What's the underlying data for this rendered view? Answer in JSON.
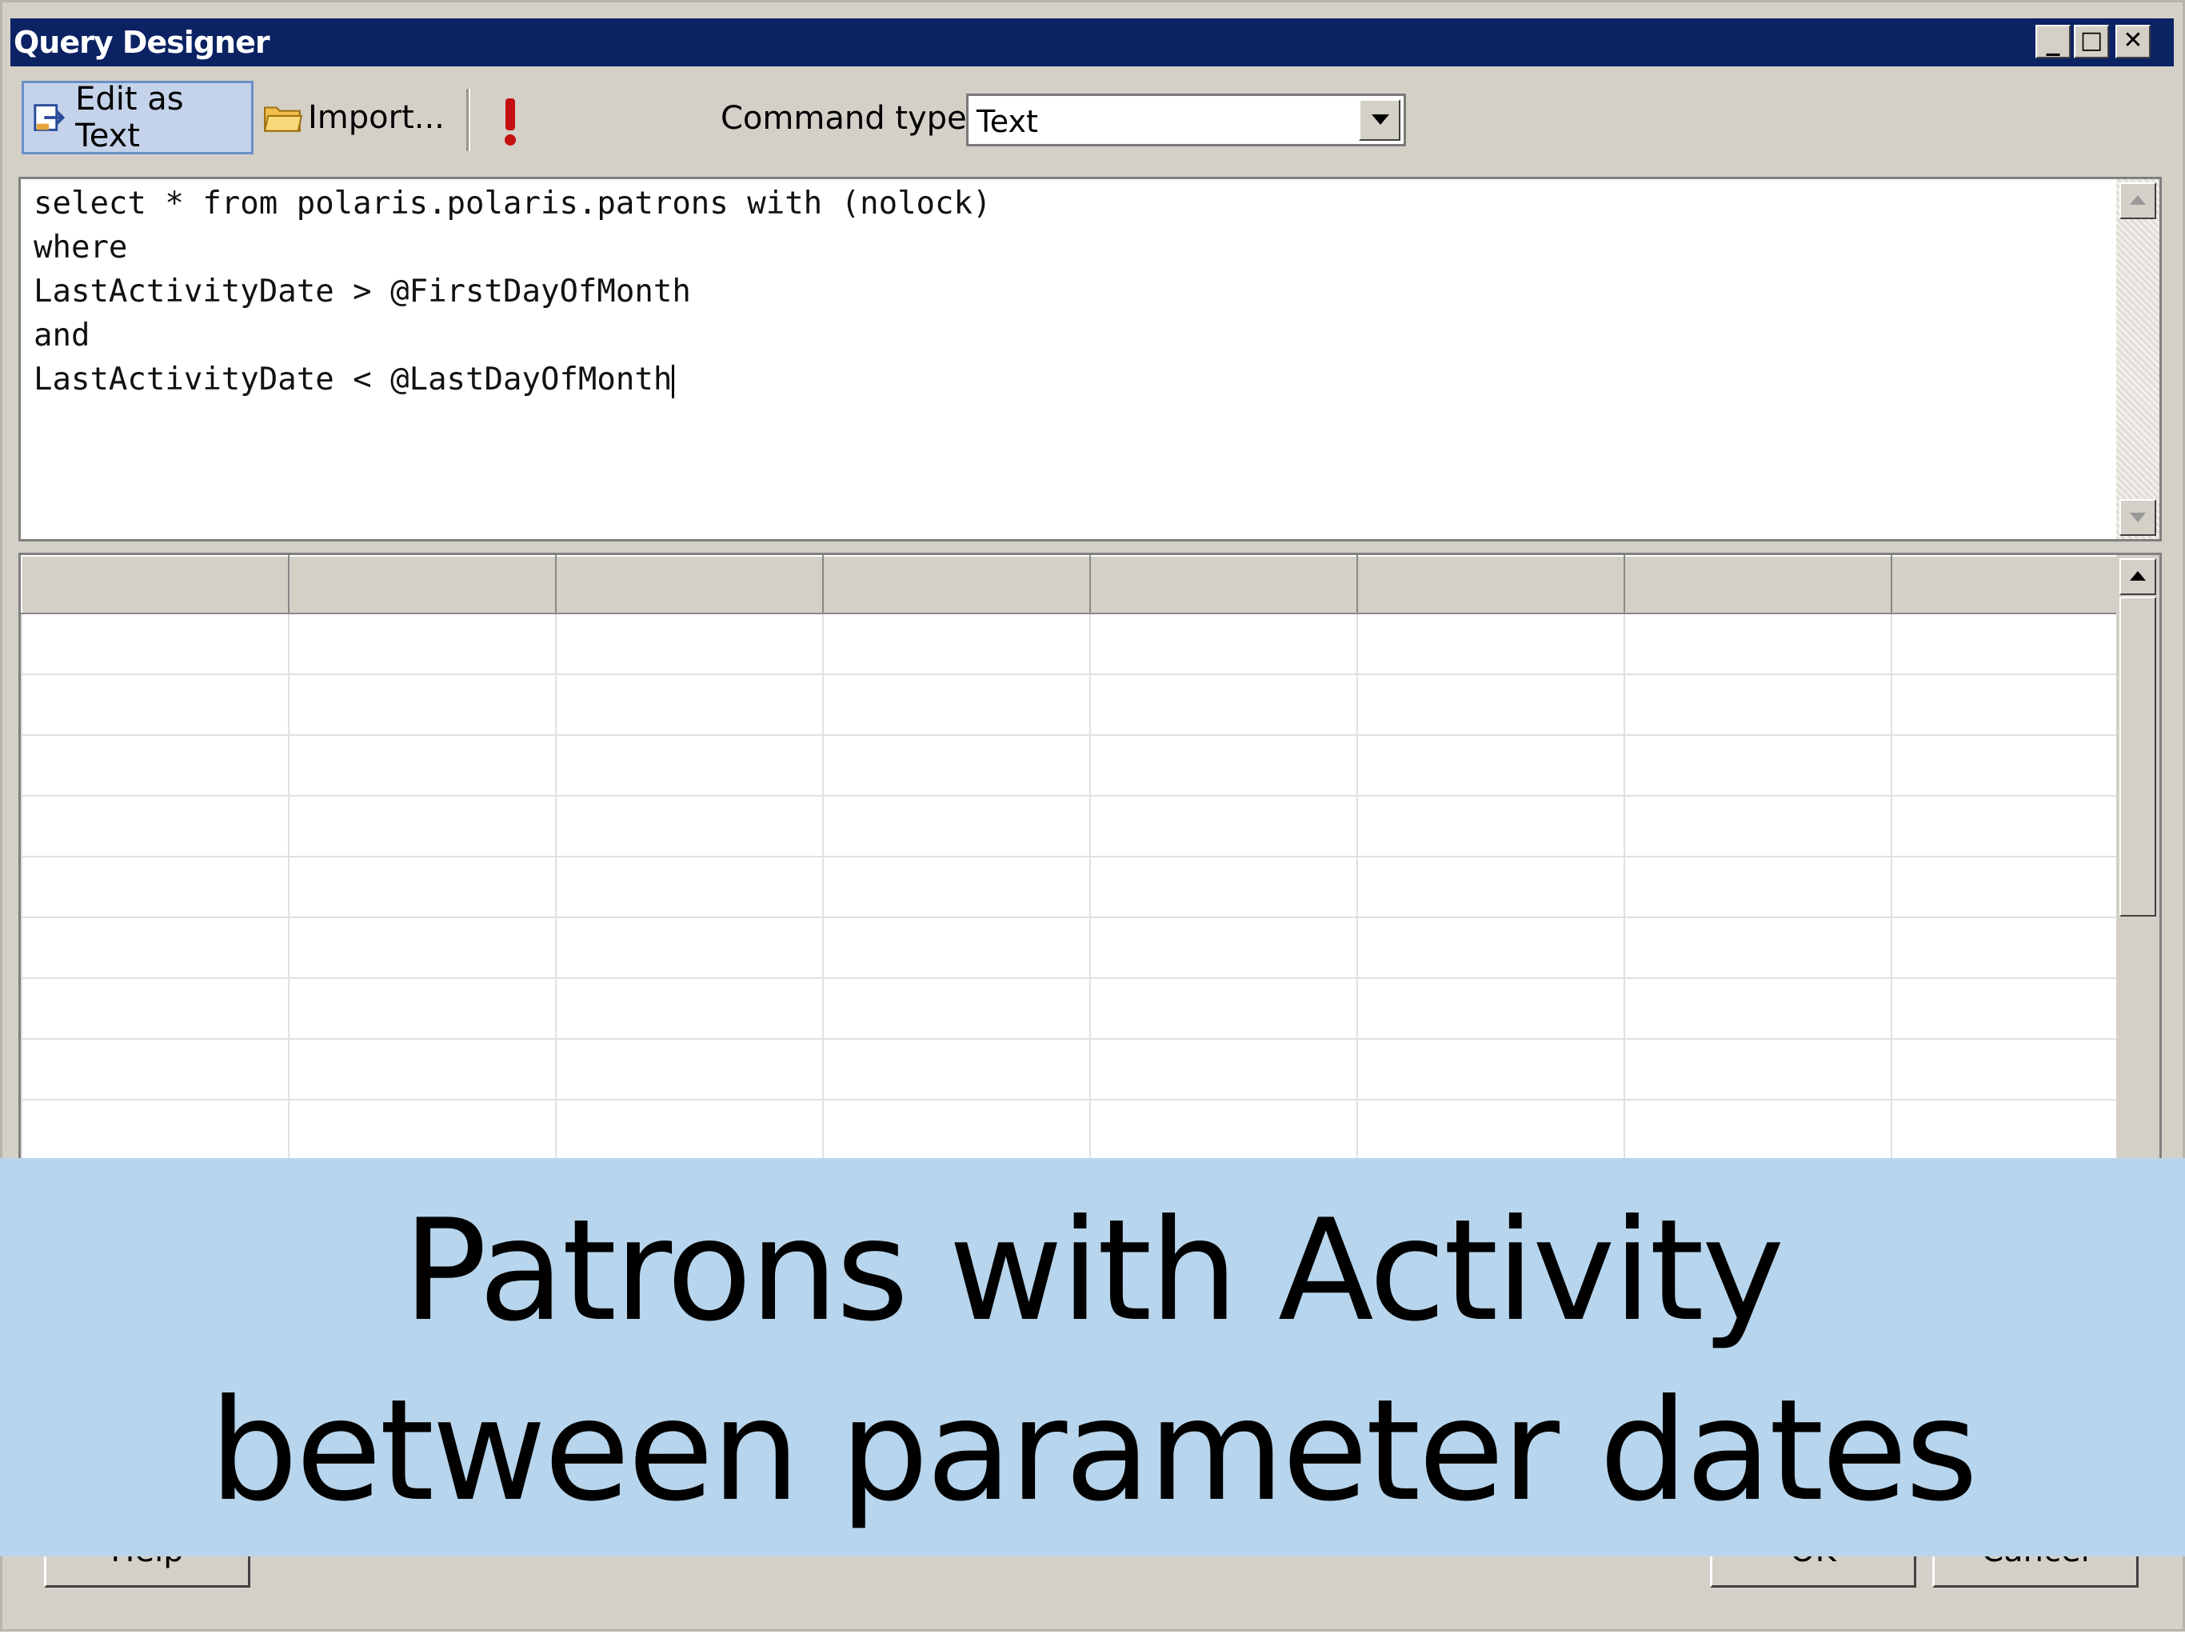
{
  "window": {
    "title": "Query Designer"
  },
  "title_buttons": [
    "_",
    "□",
    "✕"
  ],
  "toolbar": {
    "edit_as_text": "Edit as Text",
    "import": "Import...",
    "command_type_label": "Command type:",
    "command_type_value": "Text"
  },
  "editor": {
    "lines": [
      "select * from polaris.polaris.patrons with (nolock)",
      "where",
      "LastActivityDate > @FirstDayOfMonth",
      "and",
      "LastActivityDate < @LastDayOfMonth"
    ]
  },
  "footer": {
    "help": "Help",
    "ok": "OK",
    "cancel": "Cancel"
  },
  "caption": {
    "line1": "Patrons with Activity",
    "line2": "between parameter dates"
  }
}
